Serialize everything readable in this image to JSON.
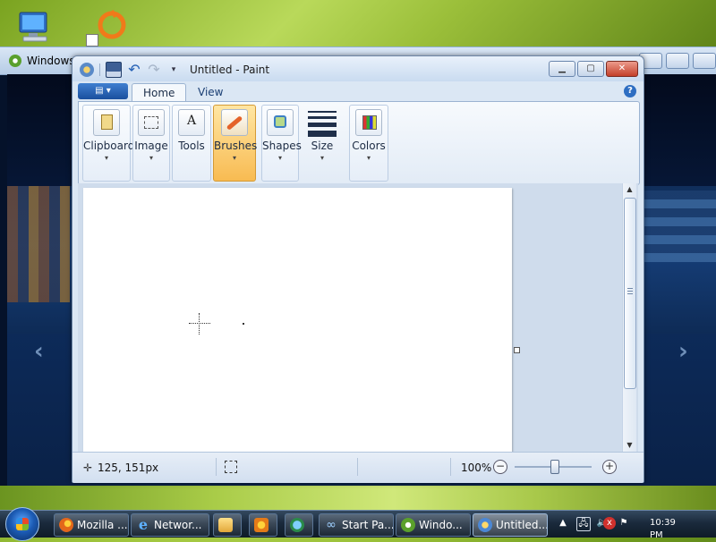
{
  "desktop": {
    "icons": [
      {
        "name": "computer"
      },
      {
        "name": "origin-shortcut"
      }
    ]
  },
  "background_window": {
    "title": "Windows",
    "icon": "media-center-icon"
  },
  "paint": {
    "title": "Untitled - Paint",
    "quick_access": [
      "paint-app-icon",
      "save-icon",
      "undo-icon",
      "redo-icon",
      "customize-dropdown"
    ],
    "window_controls": {
      "minimize": "▁",
      "maximize": "▢",
      "close": "✕"
    },
    "app_menu_label": "▤ ▾",
    "tabs": [
      {
        "label": "Home",
        "selected": true
      },
      {
        "label": "View",
        "selected": false
      }
    ],
    "help": "?",
    "groups": [
      {
        "label": "Clipboard",
        "dropdown": "▾"
      },
      {
        "label": "Image",
        "dropdown": "▾"
      },
      {
        "label": "Tools",
        "dropdown": ""
      },
      {
        "label": "Brushes",
        "dropdown": "▾",
        "active": true
      },
      {
        "label": "Shapes",
        "dropdown": "▾"
      },
      {
        "label": "Size",
        "dropdown": "▾"
      },
      {
        "label": "Colors",
        "dropdown": "▾"
      }
    ],
    "scrollbar": {
      "up": "▲",
      "down": "▼"
    },
    "status": {
      "cursor_position": "125, 151px",
      "zoom": "100%",
      "zoom_out": "−",
      "zoom_in": "+",
      "zoom_slider_fraction": 0.5
    }
  },
  "taskbar": {
    "buttons": [
      {
        "label": "Mozilla ...",
        "icon": "firefox-icon"
      },
      {
        "label": "Networ...",
        "icon": "internet-explorer-icon"
      },
      {
        "label": "",
        "icon": "folder-icon"
      },
      {
        "label": "",
        "icon": "media-player-icon"
      },
      {
        "label": "",
        "icon": "back-arrow-icon"
      },
      {
        "label": "Start Pa...",
        "icon": "start-page-icon"
      },
      {
        "label": "Windo...",
        "icon": "media-center-icon"
      },
      {
        "label": "Untitled...",
        "icon": "paint-icon",
        "active": true
      }
    ],
    "tray": {
      "show_hidden": "▲",
      "network": "🖧",
      "volume": "🔈",
      "volume_muted_badge": "x",
      "flag": "⚑"
    },
    "clock": "10:39 PM"
  },
  "colors": {
    "title_bar": "#c9dbf0",
    "ribbon_active": "#f8bb52",
    "taskbar": "#1a2a3c"
  }
}
